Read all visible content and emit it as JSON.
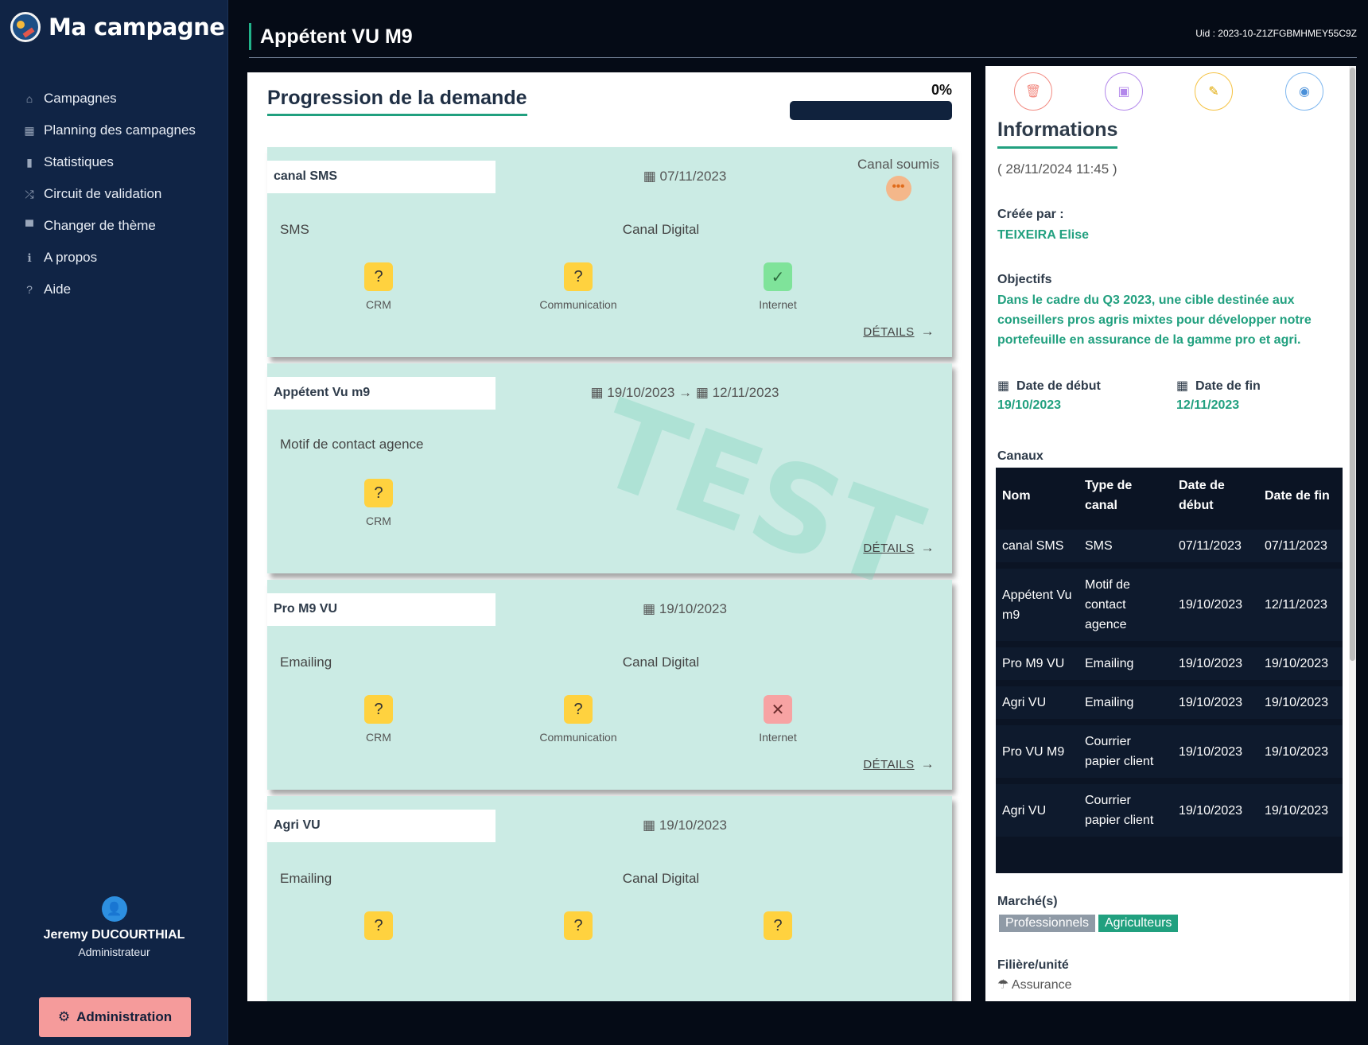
{
  "app": {
    "name": "Ma campagne"
  },
  "nav": [
    {
      "label": "Campagnes",
      "icon": "home-icon",
      "glyph": "⌂"
    },
    {
      "label": "Planning des campagnes",
      "icon": "calendar-icon",
      "glyph": "▦"
    },
    {
      "label": "Statistiques",
      "icon": "bar-chart-icon",
      "glyph": "▮"
    },
    {
      "label": "Circuit de validation",
      "icon": "shuffle-icon",
      "glyph": "⤮"
    },
    {
      "label": "Changer de thème",
      "icon": "paint-roller-icon",
      "glyph": "▀"
    },
    {
      "label": "A propos",
      "icon": "info-icon",
      "glyph": "ℹ"
    },
    {
      "label": "Aide",
      "icon": "help-icon",
      "glyph": "?"
    }
  ],
  "user": {
    "name": "Jeremy DUCOURTHIAL",
    "role": "Administrateur",
    "admin_label": "Administration"
  },
  "header": {
    "title": "Appétent VU M9",
    "uid": "Uid : 2023-10-Z1ZFGBMHMEY55C9Z"
  },
  "progression": {
    "title": "Progression de la demande",
    "percent_label": "0%",
    "percent": 0
  },
  "cards": [
    {
      "name": "canal SMS",
      "date": "07/11/2023",
      "status": "Canal soumis",
      "type": "SMS",
      "canal": "Canal Digital",
      "checks": [
        {
          "label": "CRM",
          "state": "q"
        },
        {
          "label": "Communication",
          "state": "q"
        },
        {
          "label": "Internet",
          "state": "ok"
        }
      ],
      "details": "DÉTAILS"
    },
    {
      "name": "Appétent Vu m9",
      "date": "19/10/2023",
      "date_end": "12/11/2023",
      "type": "Motif de contact agence",
      "checks": [
        {
          "label": "CRM",
          "state": "q"
        }
      ],
      "details": "DÉTAILS",
      "watermark": "TEST"
    },
    {
      "name": "Pro M9 VU",
      "date": "19/10/2023",
      "type": "Emailing",
      "canal": "Canal Digital",
      "checks": [
        {
          "label": "CRM",
          "state": "q"
        },
        {
          "label": "Communication",
          "state": "q"
        },
        {
          "label": "Internet",
          "state": "no"
        }
      ],
      "details": "DÉTAILS"
    },
    {
      "name": "Agri VU",
      "date": "19/10/2023",
      "type": "Emailing",
      "canal": "Canal Digital"
    }
  ],
  "info": {
    "title": "Informations",
    "date": "( 28/11/2024 11:45 )",
    "created_by_label": "Créée par :",
    "created_by": "TEIXEIRA Elise",
    "objectifs_label": "Objectifs",
    "objectifs": "Dans le cadre du Q3 2023, une cible destinée aux conseillers pros agris mixtes pour développer notre portefeuille en assurance de la gamme pro et agri.",
    "date_debut_label": "Date de début",
    "date_debut": "19/10/2023",
    "date_fin_label": "Date de fin",
    "date_fin": "12/11/2023",
    "canaux_label": "Canaux",
    "table_headers": [
      "Nom",
      "Type de canal",
      "Date de début",
      "Date de fin"
    ],
    "table_rows": [
      [
        "canal SMS",
        "SMS",
        "07/11/2023",
        "07/11/2023"
      ],
      [
        "Appétent Vu m9",
        "Motif de contact agence",
        "19/10/2023",
        "12/11/2023"
      ],
      [
        "Pro M9 VU",
        "Emailing",
        "19/10/2023",
        "19/10/2023"
      ],
      [
        "Agri VU",
        "Emailing",
        "19/10/2023",
        "19/10/2023"
      ],
      [
        "Pro VU M9",
        "Courrier papier client",
        "19/10/2023",
        "19/10/2023"
      ],
      [
        "Agri VU",
        "Courrier papier client",
        "19/10/2023",
        "19/10/2023"
      ]
    ],
    "marches_label": "Marché(s)",
    "marches": [
      "Professionnels",
      "Agriculteurs"
    ],
    "filiere_label": "Filière/unité",
    "filiere": "Assurance"
  },
  "colors": {
    "accent": "#21a07f",
    "sidebar": "#102445",
    "card": "#cbebe4",
    "delete": "#f28b82",
    "duplicate": "#b388eb",
    "edit": "#f5c242",
    "view": "#7fb7ef"
  }
}
